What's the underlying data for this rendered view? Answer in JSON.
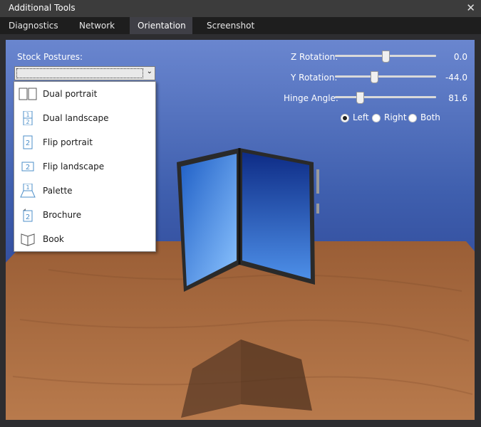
{
  "window": {
    "title": "Additional Tools",
    "close_glyph": "✕"
  },
  "tabs": [
    {
      "label": "Diagnostics",
      "active": false
    },
    {
      "label": "Network",
      "active": false
    },
    {
      "label": "Orientation",
      "active": true
    },
    {
      "label": "Screenshot",
      "active": false
    }
  ],
  "orientation": {
    "stock_postures_label": "Stock Postures:",
    "selected_posture": "",
    "postures": [
      {
        "label": "Dual portrait",
        "icon": "dual-portrait-icon"
      },
      {
        "label": "Dual landscape",
        "icon": "dual-landscape-icon",
        "glyph_top": "1",
        "glyph_bottom": "2"
      },
      {
        "label": "Flip portrait",
        "icon": "flip-portrait-icon",
        "glyph": "2"
      },
      {
        "label": "Flip landscape",
        "icon": "flip-landscape-icon",
        "glyph": "2"
      },
      {
        "label": "Palette",
        "icon": "palette-icon",
        "glyph": "1"
      },
      {
        "label": "Brochure",
        "icon": "brochure-icon",
        "glyph": "2"
      },
      {
        "label": "Book",
        "icon": "book-icon"
      }
    ],
    "z_rotation": {
      "label": "Z Rotation:",
      "value": "0.0",
      "fraction": 0.5
    },
    "y_rotation": {
      "label": "Y Rotation:",
      "value": "-44.0",
      "fraction": 0.38
    },
    "hinge_angle": {
      "label": "Hinge Angle:",
      "value": "81.6",
      "fraction": 0.23
    },
    "hinge_side": {
      "options": [
        {
          "label": "Left",
          "selected": true
        },
        {
          "label": "Right",
          "selected": false
        },
        {
          "label": "Both",
          "selected": false
        }
      ]
    }
  },
  "colors": {
    "sky_top": "#6a86cf",
    "sky_bottom": "#1c2f80",
    "floor": "#a8693f",
    "screen_left": "#3f8ee0",
    "screen_right": "#1d3f9e",
    "device_frame": "#2a2a2a"
  }
}
